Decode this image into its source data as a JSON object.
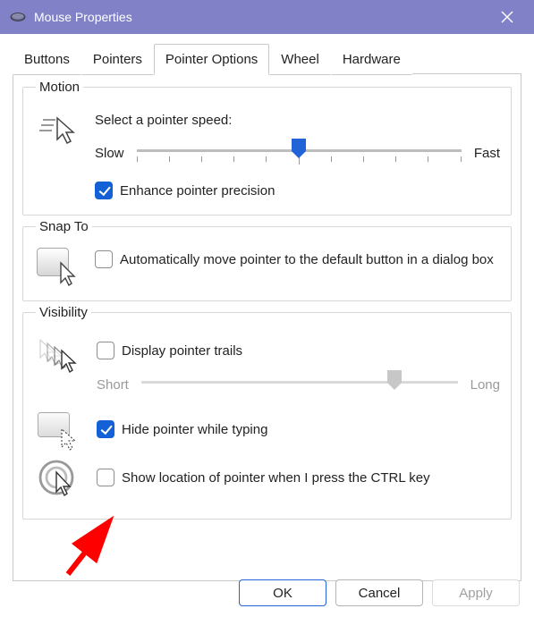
{
  "window": {
    "title": "Mouse Properties"
  },
  "tabs": {
    "items": [
      "Buttons",
      "Pointers",
      "Pointer Options",
      "Wheel",
      "Hardware"
    ],
    "active_index": 2
  },
  "motion": {
    "legend": "Motion",
    "speed_label": "Select a pointer speed:",
    "slow_label": "Slow",
    "fast_label": "Fast",
    "speed_value": 6,
    "speed_max": 11,
    "enhance_precision_label": "Enhance pointer precision",
    "enhance_precision_checked": true
  },
  "snap_to": {
    "legend": "Snap To",
    "auto_move_label": "Automatically move pointer to the default button in a dialog box",
    "auto_move_checked": false
  },
  "visibility": {
    "legend": "Visibility",
    "trails_label": "Display pointer trails",
    "trails_checked": false,
    "trails_short_label": "Short",
    "trails_long_label": "Long",
    "trails_value": 9,
    "trails_max": 11,
    "hide_typing_label": "Hide pointer while typing",
    "hide_typing_checked": true,
    "show_ctrl_label": "Show location of pointer when I press the CTRL key",
    "show_ctrl_checked": false
  },
  "buttons": {
    "ok": "OK",
    "cancel": "Cancel",
    "apply": "Apply"
  }
}
